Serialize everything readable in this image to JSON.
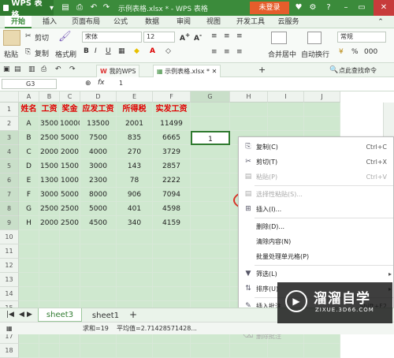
{
  "titlebar": {
    "app": "WPS 表格",
    "doc": "示例表格.xlsx * - WPS 表格",
    "login": "未登录"
  },
  "menu": {
    "items": [
      "开始",
      "插入",
      "页面布局",
      "公式",
      "数据",
      "审阅",
      "视图",
      "开发工具",
      "云服务"
    ]
  },
  "toolbar": {
    "paste": "粘贴",
    "cut": "剪切",
    "copy": "复制",
    "format_painter": "格式刷",
    "font": "宋体",
    "size": "12",
    "merge": "合并居中",
    "wrap": "自动换行",
    "numfmt": "常规"
  },
  "tabs": {
    "home": "我的WPS",
    "doc": "示例表格.xlsx *",
    "search": "点此查找命令"
  },
  "formula": {
    "cell": "G3",
    "fx": "fx",
    "value": "1"
  },
  "grid": {
    "cols": [
      "A",
      "B",
      "C",
      "D",
      "E",
      "F",
      "G",
      "H",
      "I",
      "J"
    ],
    "rows": [
      "1",
      "2",
      "3",
      "4",
      "5",
      "6",
      "7",
      "8",
      "9",
      "10",
      "11",
      "12",
      "13",
      "14",
      "15",
      "16",
      "17",
      "18"
    ],
    "header": [
      "姓名",
      "工资",
      "奖金",
      "应发工资",
      "所得税",
      "实发工资"
    ],
    "data": [
      [
        "A",
        "3500",
        "10000",
        "13500",
        "2001",
        "11499"
      ],
      [
        "B",
        "2500",
        "5000",
        "7500",
        "835",
        "6665"
      ],
      [
        "C",
        "2000",
        "2000",
        "4000",
        "270",
        "3729"
      ],
      [
        "D",
        "1500",
        "1500",
        "3000",
        "143",
        "2857"
      ],
      [
        "E",
        "1300",
        "1000",
        "2300",
        "78",
        "2222"
      ],
      [
        "F",
        "3000",
        "5000",
        "8000",
        "906",
        "7094"
      ],
      [
        "G",
        "2500",
        "2500",
        "5000",
        "401",
        "4598"
      ],
      [
        "H",
        "2000",
        "2500",
        "4500",
        "340",
        "4159"
      ]
    ],
    "g3": "1"
  },
  "context_menu": {
    "items": [
      {
        "label": "复制(C)",
        "shortcut": "Ctrl+C",
        "icon": "copy-icon",
        "disabled": false
      },
      {
        "label": "剪切(T)",
        "shortcut": "Ctrl+X",
        "icon": "scissors-icon",
        "disabled": false
      },
      {
        "label": "粘贴(P)",
        "shortcut": "Ctrl+V",
        "icon": "paste-icon",
        "disabled": true
      },
      {
        "label": "选择性粘贴(S)...",
        "shortcut": "",
        "icon": "paste-special-icon",
        "disabled": true
      },
      {
        "label": "插入(I)...",
        "shortcut": "",
        "icon": "insert-icon",
        "disabled": false
      },
      {
        "label": "删除(D)...",
        "shortcut": "",
        "icon": "",
        "disabled": false
      },
      {
        "label": "清除内容(N)",
        "shortcut": "",
        "icon": "",
        "disabled": false
      },
      {
        "label": "批量处理单元格(P)",
        "shortcut": "",
        "icon": "",
        "disabled": false
      },
      {
        "label": "筛选(L)",
        "shortcut": "",
        "icon": "filter-icon",
        "disabled": false
      },
      {
        "label": "排序(U)",
        "shortcut": "",
        "icon": "sort-icon",
        "disabled": false
      },
      {
        "label": "插入批注",
        "shortcut": "Shift+F2",
        "icon": "comment-icon",
        "disabled": false
      },
      {
        "label": "编辑批注",
        "shortcut": "",
        "icon": "edit-comment-icon",
        "disabled": true
      },
      {
        "label": "删除批注",
        "shortcut": "",
        "icon": "delete-comment-icon",
        "disabled": true
      }
    ]
  },
  "sheets": {
    "active": "sheet3",
    "other": "sheet1",
    "add": "+"
  },
  "status": {
    "sum": "求和=19",
    "avg": "平均值=2.71428571428..."
  },
  "watermark": {
    "title": "溜溜自学",
    "sub": "ZIXUE.3D66.COM"
  }
}
